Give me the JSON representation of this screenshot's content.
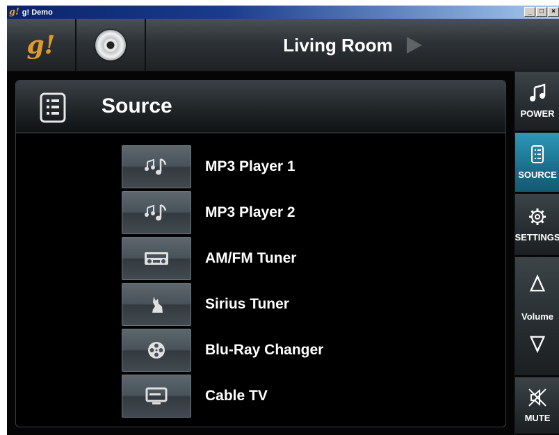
{
  "window": {
    "title": "g! Demo",
    "app_icon_text": "g!",
    "controls": {
      "minimize": "_",
      "maximize": "□",
      "close": "×"
    }
  },
  "header": {
    "logo": "g!",
    "room": "Living Room"
  },
  "panel": {
    "title": "Source",
    "sources": [
      {
        "label": "MP3 Player 1",
        "icon": "music-notes-icon"
      },
      {
        "label": "MP3 Player 2",
        "icon": "music-notes-icon"
      },
      {
        "label": "AM/FM Tuner",
        "icon": "radio-icon"
      },
      {
        "label": "Sirius Tuner",
        "icon": "dog-icon"
      },
      {
        "label": "Blu-Ray Changer",
        "icon": "film-reel-icon"
      },
      {
        "label": "Cable TV",
        "icon": "tv-icon"
      }
    ]
  },
  "side_nav": {
    "power": "POWER",
    "source": "SOURCE",
    "settings": "SETTINGS",
    "volume": "Volume",
    "mute": "MUTE",
    "active": "SOURCE"
  },
  "colors": {
    "accent_active": "#2e97b8",
    "logo_orange": "#e09a2a",
    "background": "#000000"
  }
}
